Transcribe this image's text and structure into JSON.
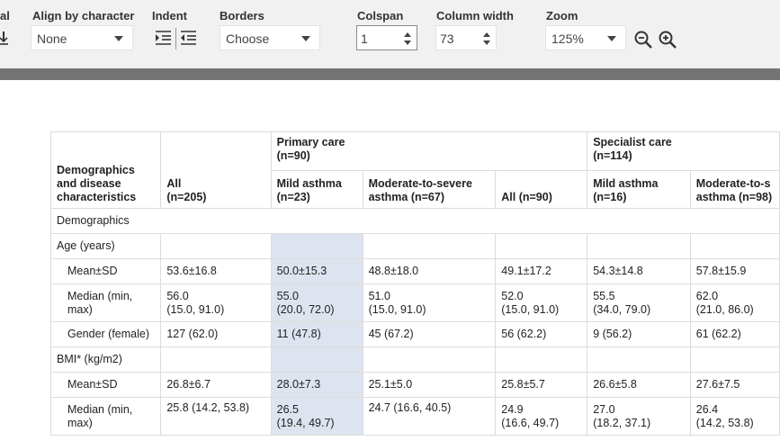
{
  "toolbar": {
    "partial_label": "al",
    "align_label": "Align by character",
    "align_value": "None",
    "indent_label": "Indent",
    "borders_label": "Borders",
    "borders_value": "Choose",
    "colspan_label": "Colspan",
    "colspan_value": "1",
    "colwidth_label": "Column width",
    "colwidth_value": "73",
    "zoom_label": "Zoom",
    "zoom_value": "125%"
  },
  "table": {
    "header": {
      "demographics": "Demographics and disease characteristics",
      "all_label": "All",
      "all_n": "(n=205)",
      "primary_care": "Primary care",
      "primary_n": "(n=90)",
      "specialist_care": "Specialist care",
      "specialist_n": "(n=114)",
      "pc_mild": "Mild asthma",
      "pc_mild_n": "(n=23)",
      "pc_mod": "Moderate-to-severe",
      "pc_mod_n": "asthma (n=67)",
      "pc_all": "All (n=90)",
      "sc_mild": "Mild asthma",
      "sc_mild_n": "(n=16)",
      "sc_mod": "Moderate-to-s",
      "sc_mod_n": "asthma (n=98)"
    },
    "rows": [
      {
        "label": "Demographics",
        "section": true,
        "cells": []
      },
      {
        "label": "Age (years)",
        "cells": [
          "",
          "",
          "",
          "",
          "",
          ""
        ]
      },
      {
        "label": "Mean±SD",
        "cells": [
          "53.6±16.8",
          "50.0±15.3",
          "48.8±18.0",
          "49.1±17.2",
          "54.3±14.8",
          "57.8±15.9"
        ]
      },
      {
        "label": "Median (min, max)",
        "cells": [
          "56.0\n(15.0, 91.0)",
          "55.0\n(20.0, 72.0)",
          "51.0\n(15.0, 91.0)",
          "52.0\n(15.0, 91.0)",
          "55.5\n(34.0, 79.0)",
          "62.0\n(21.0, 86.0)"
        ]
      },
      {
        "label": "Gender (female)",
        "cells": [
          "127 (62.0)",
          "11 (47.8)",
          "45 (67.2)",
          "56 (62.2)",
          "9 (56.2)",
          "61 (62.2)"
        ]
      },
      {
        "label": "BMI* (kg/m2)",
        "cells": [
          "",
          "",
          "",
          "",
          "",
          ""
        ]
      },
      {
        "label": "Mean±SD",
        "cells": [
          "26.8±6.7",
          "28.0±7.3",
          "25.1±5.0",
          "25.8±5.7",
          "26.6±5.8",
          "27.6±7.5"
        ]
      },
      {
        "label": "Median (min, max)",
        "cells": [
          "25.8 (14.2, 53.8)",
          "26.5\n(19.4, 49.7)",
          "24.7 (16.6, 40.5)",
          "24.9\n(16.6, 49.7)",
          "27.0\n(18.2, 37.1)",
          "26.4\n(14.2, 53.8)"
        ]
      }
    ]
  }
}
